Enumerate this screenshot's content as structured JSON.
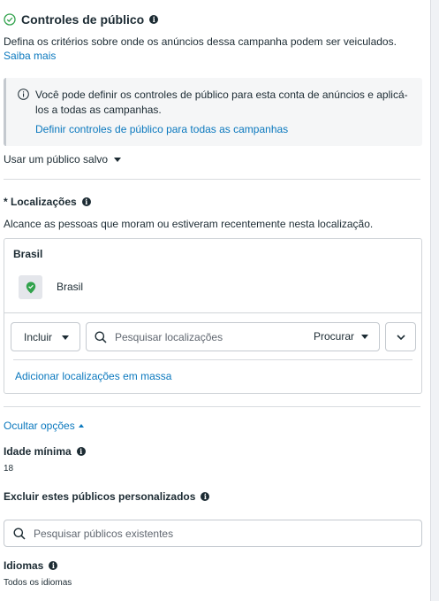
{
  "section": {
    "title": "Controles de público",
    "description": "Defina os critérios sobre onde os anúncios dessa campanha podem ser veiculados.",
    "learn_more": "Saiba mais"
  },
  "notice": {
    "text": "Você pode definir os controles de público para esta conta de anúncios e aplicá-los a todas as campanhas.",
    "link": "Definir controles de público para todas as campanhas"
  },
  "saved_audience": {
    "label": "Usar um público salvo"
  },
  "locations": {
    "title": "* Localizações",
    "description": "Alcance as pessoas que moram ou estiveram recentemente nesta localização.",
    "group_header": "Brasil",
    "selected_item": "Brasil",
    "include_label": "Incluir",
    "search_placeholder": "Pesquisar localizações",
    "search_mode": "Procurar",
    "bulk_link": "Adicionar localizações em massa"
  },
  "options": {
    "toggle_label": "Ocultar opções",
    "min_age_title": "Idade mínima",
    "min_age_value": "18",
    "exclude_title": "Excluir estes públicos personalizados",
    "exclude_placeholder": "Pesquisar públicos existentes",
    "languages_title": "Idiomas",
    "languages_value": "Todos os idiomas"
  },
  "colors": {
    "link": "#0a78be",
    "text": "#1c2b33",
    "pin": "#31a24c",
    "notice_bg": "#f5f6f7"
  }
}
